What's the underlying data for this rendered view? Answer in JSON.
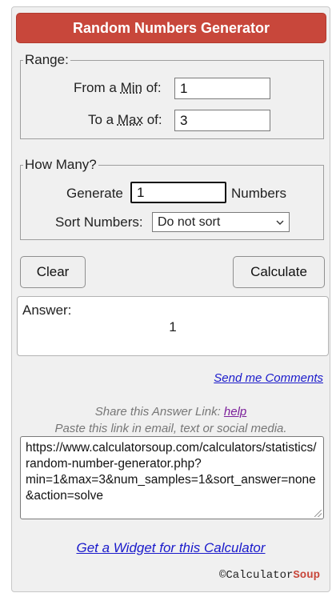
{
  "title": "Random Numbers Generator",
  "range": {
    "legend": "Range:",
    "min_label_pre": "From a ",
    "min_label_abbr": "Min",
    "min_label_post": " of:",
    "min_value": "1",
    "max_label_pre": "To a ",
    "max_label_abbr": "Max",
    "max_label_post": " of:",
    "max_value": "3"
  },
  "how_many": {
    "legend": "How Many?",
    "generate_label": "Generate",
    "count_value": "1",
    "numbers_label": "Numbers",
    "sort_label": "Sort Numbers:",
    "sort_selected": "Do not sort"
  },
  "buttons": {
    "clear": "Clear",
    "calculate": "Calculate"
  },
  "answer": {
    "label": "Answer:",
    "value": "1"
  },
  "comments_link": "Send me Comments",
  "share": {
    "text": "Share this Answer Link: ",
    "help": "help",
    "paste_hint": "Paste this link in email, text or social media.",
    "url": "https://www.calculatorsoup.com/calculators/statistics/random-number-generator.php?min=1&max=3&num_samples=1&sort_answer=none&action=solve"
  },
  "widget_link": "Get a Widget for this Calculator",
  "brand": {
    "copyright": "©",
    "name": "Calculator",
    "name_accent": "Soup"
  },
  "colors": {
    "title_bg": "#c8473b",
    "link": "#1a1acb",
    "brand_accent": "#c8473b"
  }
}
